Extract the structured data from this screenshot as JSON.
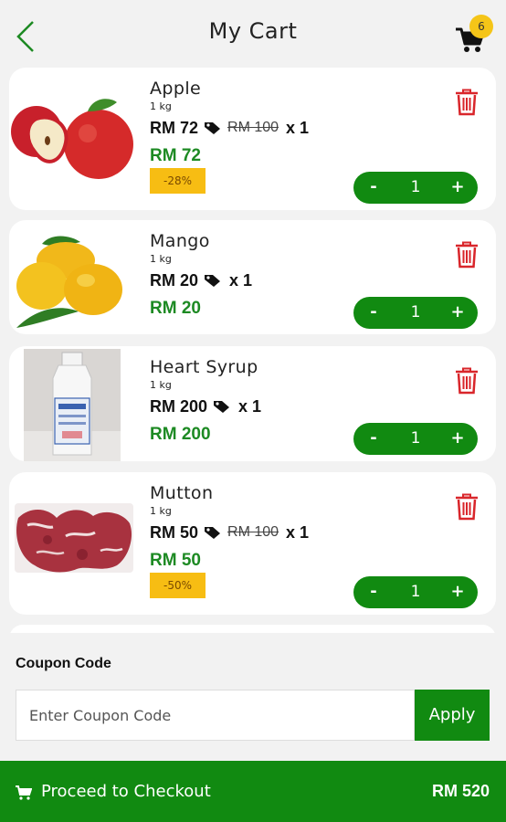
{
  "header": {
    "title": "My Cart",
    "back_icon": "chevron-left-icon",
    "cart_icon": "cart-icon",
    "cart_badge": "6"
  },
  "cart": {
    "items": [
      {
        "name": "Apple",
        "unit": "1 kg",
        "price": "RM 72",
        "original_price": "RM 100",
        "quantity_text": "x  1",
        "total": "RM 72",
        "discount": "-28%",
        "stepper_qty": "1",
        "image_icon": "apple-image"
      },
      {
        "name": "Mango",
        "unit": "1 kg",
        "price": "RM 20",
        "quantity_text": "x  1",
        "total": "RM 20",
        "stepper_qty": "1",
        "image_icon": "mango-image"
      },
      {
        "name": "Heart Syrup",
        "unit": "1 kg",
        "price": "RM 200",
        "quantity_text": "x  1",
        "total": "RM 200",
        "stepper_qty": "1",
        "image_icon": "syrup-bottle-image"
      },
      {
        "name": "Mutton",
        "unit": "1 kg",
        "price": "RM 50",
        "original_price": "RM 100",
        "quantity_text": "x  1",
        "total": "RM 50",
        "discount": "-50%",
        "stepper_qty": "1",
        "image_icon": "mutton-image"
      }
    ],
    "stepper": {
      "minus": "-",
      "plus": "+"
    },
    "delete_icon": "trash-icon",
    "tag_icon": "price-tag-icon"
  },
  "coupon": {
    "label": "Coupon Code",
    "placeholder": "Enter Coupon Code",
    "value": "",
    "apply_label": "Apply"
  },
  "checkout": {
    "label": "Proceed to Checkout",
    "total": "RM 520",
    "icon": "cart-icon"
  },
  "colors": {
    "brand_green": "#118a11",
    "price_green": "#1d8a23",
    "discount_yellow": "#f7bd13",
    "badge_yellow": "#f5c518",
    "delete_red": "#d9262b"
  }
}
